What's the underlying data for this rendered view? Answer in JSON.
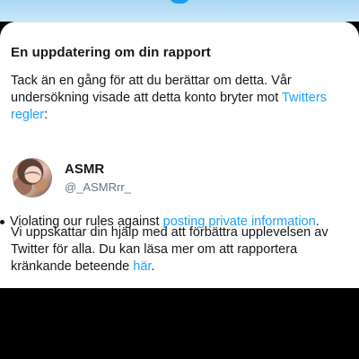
{
  "header": {
    "title": "En uppdatering om din rapport"
  },
  "message": {
    "paragraph1_text": "Tack än en gång för att du berättar om detta. Vår undersökning visade att detta konto bryter mot ",
    "paragraph1_link": "Twitters regler",
    "paragraph1_end": ":",
    "violation_prefix": "Violating our rules against ",
    "violation_link": "posting private information",
    "violation_end": ".",
    "paragraph2_text": "Vi uppskattar din hjälp med att förbättra upplevelsen av Twitter för alla. Du kan läsa mer om att rapportera kränkande beteende ",
    "paragraph2_link": "här",
    "paragraph2_end": "."
  },
  "reported_account": {
    "name": "ASMR",
    "handle": "@_ASMRrr_"
  },
  "colors": {
    "link": "#1da1f2",
    "text": "#14171a",
    "secondary_text": "#657786",
    "background": "#ffffff",
    "bottom_area": "#000000",
    "top_accent": "#1d9bf0"
  },
  "icons": {
    "avatar": "profile-avatar",
    "bullet": "bullet-dot"
  }
}
